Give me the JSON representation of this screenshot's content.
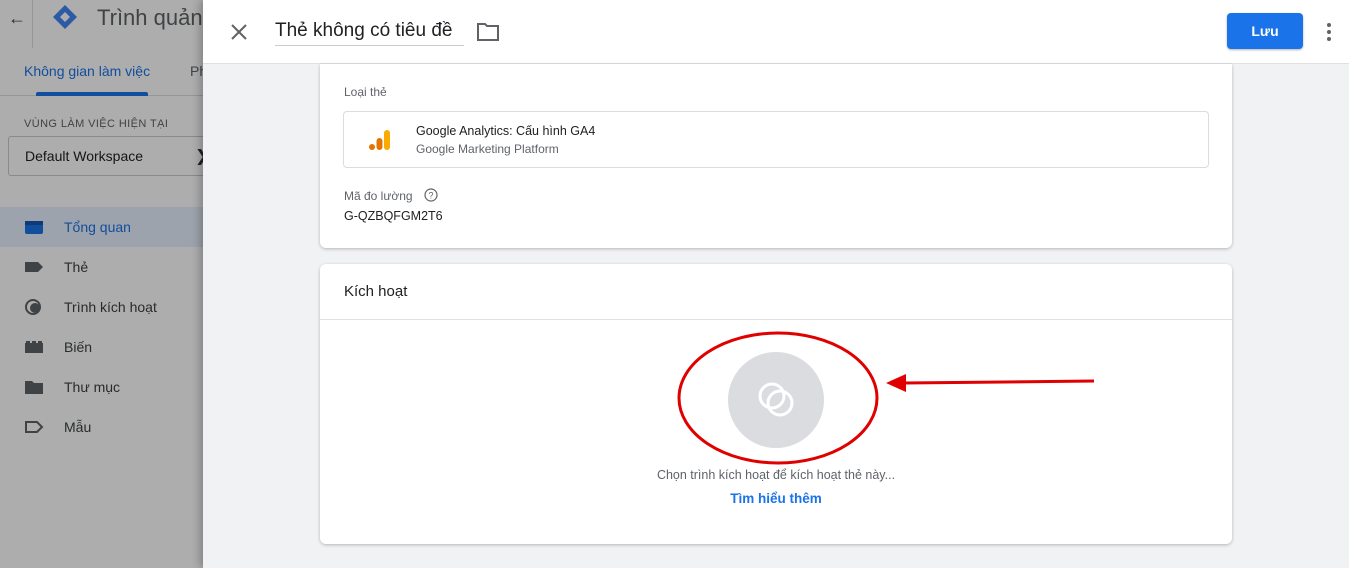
{
  "background_app": {
    "title": "Trình quản",
    "tabs": {
      "active": "Không gian làm việc",
      "next": "Ph"
    },
    "workspace": {
      "label": "VÙNG LÀM VIỆC HIỆN TẠI",
      "name": "Default Workspace"
    },
    "nav": [
      {
        "label": "Tổng quan",
        "icon": "overview-icon",
        "active": true
      },
      {
        "label": "Thẻ",
        "icon": "tag-icon",
        "active": false
      },
      {
        "label": "Trình kích hoạt",
        "icon": "trigger-icon",
        "active": false
      },
      {
        "label": "Biến",
        "icon": "variable-icon",
        "active": false
      },
      {
        "label": "Thư mục",
        "icon": "folder-icon",
        "active": false
      },
      {
        "label": "Mẫu",
        "icon": "template-icon",
        "active": false
      }
    ]
  },
  "panel": {
    "title": "Thẻ không có tiêu đề",
    "save_label": "Lưu",
    "config": {
      "tag_type_label": "Loại thẻ",
      "tag_type_name": "Google Analytics: Cấu hình GA4",
      "tag_type_provider": "Google Marketing Platform",
      "measurement_id_label": "Mã đo lường",
      "measurement_id_value": "G-QZBQFGM2T6"
    },
    "triggering": {
      "title": "Kích hoạt",
      "hint": "Chọn trình kích hoạt để kích hoạt thẻ này...",
      "learn_more": "Tìm hiểu thêm"
    }
  },
  "colors": {
    "accent": "#1a73e8",
    "annotation": "#e00000",
    "ga_orange": "#f9ab00",
    "ga_dark": "#e37400"
  }
}
